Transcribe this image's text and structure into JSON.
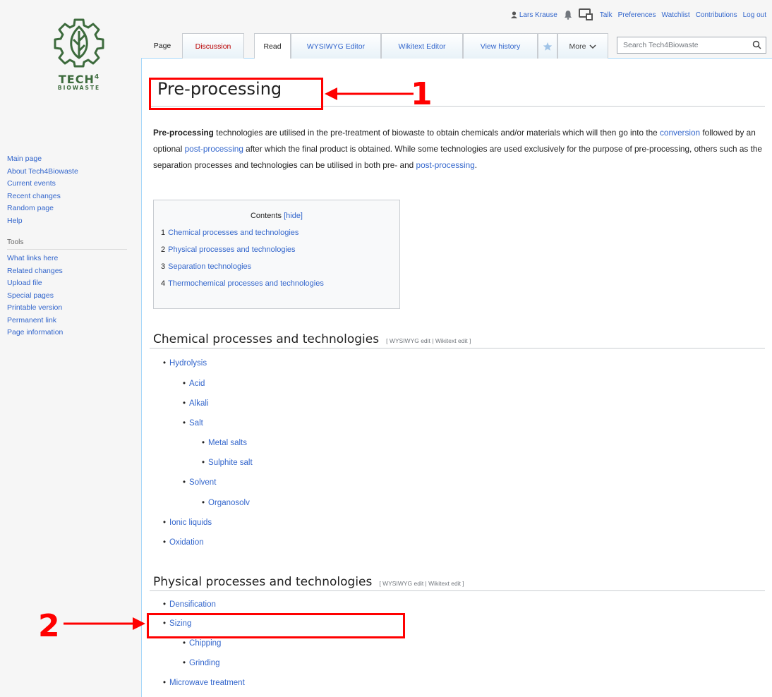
{
  "personal_bar": {
    "username": "Lars Krause",
    "links": [
      "Talk",
      "Preferences",
      "Watchlist",
      "Contributions",
      "Log out"
    ]
  },
  "logo": {
    "brand_line1": "TECH",
    "brand_sup": "4",
    "brand_line2": "BIOWASTE",
    "color": "#3d6b3d"
  },
  "sidebar": {
    "nav": [
      "Main page",
      "About Tech4Biowaste",
      "Current events",
      "Recent changes",
      "Random page",
      "Help"
    ],
    "tools_heading": "Tools",
    "tools": [
      "What links here",
      "Related changes",
      "Upload file",
      "Special pages",
      "Printable version",
      "Permanent link",
      "Page information"
    ]
  },
  "tabs": {
    "page": "Page",
    "discussion": "Discussion",
    "read": "Read",
    "wysiwyg": "WYSIWYG Editor",
    "wikitext": "Wikitext Editor",
    "history": "View history",
    "more": "More"
  },
  "search": {
    "placeholder": "Search Tech4Biowaste"
  },
  "article": {
    "title": "Pre-processing",
    "intro": {
      "bold": "Pre-processing",
      "t1": " technologies are utilised in the pre-treatment of biowaste to obtain chemicals and/or materials which will then go into the ",
      "link1": "conversion",
      "t2": " followed by an optional ",
      "link2": "post-processing",
      "t3": " after which the final product is obtained. While some technologies are used exclusively for the purpose of pre-processing, others such as the separation processes and technologies can be utilised in both pre- and ",
      "link3": "post-processing",
      "t4": "."
    },
    "toc": {
      "title": "Contents",
      "hide": "[hide]",
      "items": [
        {
          "num": "1",
          "label": "Chemical processes and technologies"
        },
        {
          "num": "2",
          "label": "Physical processes and technologies"
        },
        {
          "num": "3",
          "label": "Separation technologies"
        },
        {
          "num": "4",
          "label": "Thermochemical processes and technologies"
        }
      ]
    },
    "sections": [
      {
        "title": "Chemical processes and technologies",
        "edit": "[ WYSIWYG edit | Wikitext edit ]"
      },
      {
        "title": "Physical processes and technologies",
        "edit": "[ WYSIWYG edit | Wikitext edit ]"
      }
    ],
    "chemical_list": [
      "Hydrolysis",
      "Acid",
      "Alkali",
      "Salt",
      "Metal salts",
      "Sulphite salt",
      "Solvent",
      "Organosolv",
      "Ionic liquids",
      "Oxidation"
    ],
    "physical_list": [
      "Densification",
      "Sizing",
      "Chipping",
      "Grinding",
      "Microwave treatment"
    ]
  },
  "annotations": {
    "label1": "1",
    "label2": "2",
    "color": "#ff0000"
  }
}
